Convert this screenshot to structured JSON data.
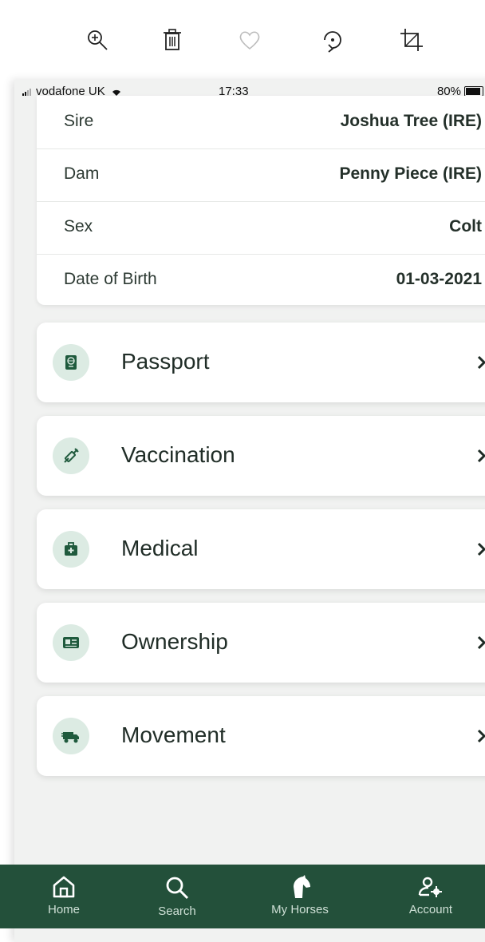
{
  "viewer_toolbar": {
    "icons": [
      "zoom-in-icon",
      "trash-icon",
      "heart-icon",
      "rotate-icon",
      "crop-icon"
    ]
  },
  "status_bar": {
    "carrier": "vodafone UK",
    "time": "17:33",
    "battery": "80%",
    "battery_level": 0.8
  },
  "details": [
    {
      "label": "Sire",
      "value": "Joshua Tree (IRE)"
    },
    {
      "label": "Dam",
      "value": "Penny Piece (IRE)"
    },
    {
      "label": "Sex",
      "value": "Colt"
    },
    {
      "label": "Date of Birth",
      "value": "01-03-2021"
    }
  ],
  "menu": [
    {
      "label": "Passport",
      "icon": "passport-icon"
    },
    {
      "label": "Vaccination",
      "icon": "syringe-icon"
    },
    {
      "label": "Medical",
      "icon": "medical-kit-icon"
    },
    {
      "label": "Ownership",
      "icon": "id-card-icon"
    },
    {
      "label": "Movement",
      "icon": "horsebox-icon"
    }
  ],
  "bottom_nav": [
    {
      "label": "Home",
      "icon": "home-icon"
    },
    {
      "label": "Search",
      "icon": "search-icon"
    },
    {
      "label": "My Horses",
      "icon": "horse-head-icon"
    },
    {
      "label": "Account",
      "icon": "account-settings-icon"
    }
  ],
  "colors": {
    "accent": "#23503a",
    "icon_bg": "#dcebe3",
    "icon_fg": "#1f5a3d",
    "background": "#f1f2f1"
  }
}
